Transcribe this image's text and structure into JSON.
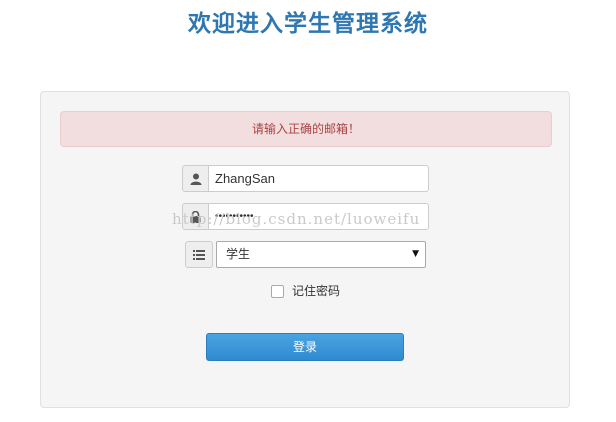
{
  "page": {
    "title": "欢迎进入学生管理系统"
  },
  "alert": {
    "message": "请输入正确的邮箱！"
  },
  "form": {
    "username_value": "ZhangSan",
    "password_mask": "•••••••••••",
    "role_selected": "学生",
    "remember_label": "记住密码",
    "remember_checked": false,
    "login_label": "登录"
  },
  "watermark": {
    "text": "http://blog.csdn.net/luoweifu"
  },
  "icons": {
    "user": "user-icon",
    "lock": "lock-icon",
    "list": "list-icon",
    "dropdown": "caret-down-icon"
  },
  "colors": {
    "title": "#2e77b0",
    "alert_bg": "#f2dede",
    "alert_text": "#a94442",
    "button": "#3a96d8"
  }
}
